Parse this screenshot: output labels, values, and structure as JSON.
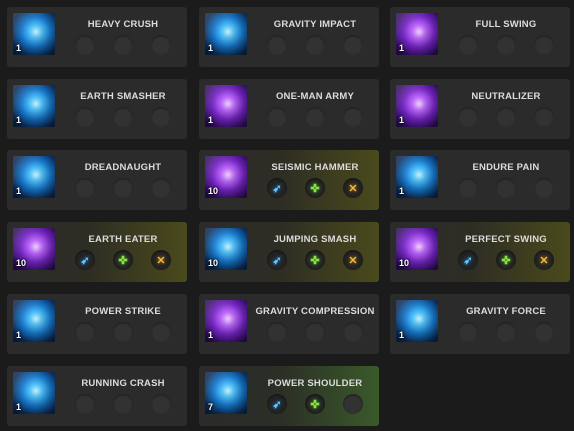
{
  "skills": [
    {
      "name": "HEAVY CRUSH",
      "level": "1",
      "theme": "blue",
      "highlight": "none",
      "tripods": [
        "",
        "",
        ""
      ]
    },
    {
      "name": "GRAVITY IMPACT",
      "level": "1",
      "theme": "blue",
      "highlight": "none",
      "tripods": [
        "",
        "",
        ""
      ]
    },
    {
      "name": "FULL SWING",
      "level": "1",
      "theme": "purple",
      "highlight": "none",
      "tripods": [
        "",
        "",
        ""
      ]
    },
    {
      "name": "EARTH SMASHER",
      "level": "1",
      "theme": "blue",
      "highlight": "none",
      "tripods": [
        "",
        "",
        ""
      ]
    },
    {
      "name": "ONE-MAN ARMY",
      "level": "1",
      "theme": "purple",
      "highlight": "none",
      "tripods": [
        "",
        "",
        ""
      ]
    },
    {
      "name": "NEUTRALIZER",
      "level": "1",
      "theme": "purple",
      "highlight": "none",
      "tripods": [
        "",
        "",
        ""
      ]
    },
    {
      "name": "DREADNAUGHT",
      "level": "1",
      "theme": "blue",
      "highlight": "none",
      "tripods": [
        "",
        "",
        ""
      ]
    },
    {
      "name": "SEISMIC HAMMER",
      "level": "10",
      "theme": "purple",
      "highlight": "yellow",
      "tripods": [
        "blue",
        "green",
        "gold"
      ]
    },
    {
      "name": "ENDURE PAIN",
      "level": "1",
      "theme": "blue",
      "highlight": "none",
      "tripods": [
        "",
        "",
        ""
      ]
    },
    {
      "name": "EARTH EATER",
      "level": "10",
      "theme": "purple",
      "highlight": "yellow",
      "tripods": [
        "blue",
        "green",
        "gold"
      ]
    },
    {
      "name": "JUMPING SMASH",
      "level": "10",
      "theme": "blue",
      "highlight": "yellow",
      "tripods": [
        "blue",
        "green",
        "gold"
      ]
    },
    {
      "name": "PERFECT SWING",
      "level": "10",
      "theme": "purple",
      "highlight": "yellow",
      "tripods": [
        "blue",
        "green",
        "gold"
      ]
    },
    {
      "name": "POWER STRIKE",
      "level": "1",
      "theme": "blue",
      "highlight": "none",
      "tripods": [
        "",
        "",
        ""
      ]
    },
    {
      "name": "GRAVITY COMPRESSION",
      "level": "1",
      "theme": "purple",
      "highlight": "none",
      "tripods": [
        "",
        "",
        ""
      ]
    },
    {
      "name": "GRAVITY FORCE",
      "level": "1",
      "theme": "blue",
      "highlight": "none",
      "tripods": [
        "",
        "",
        ""
      ]
    },
    {
      "name": "RUNNING CRASH",
      "level": "1",
      "theme": "blue",
      "highlight": "none",
      "tripods": [
        "",
        "",
        ""
      ]
    },
    {
      "name": "POWER SHOULDER",
      "level": "7",
      "theme": "blue",
      "highlight": "green",
      "tripods": [
        "blue",
        "green",
        ""
      ]
    }
  ],
  "tripod_glyphs": {
    "blue": "➶",
    "green": "✜",
    "gold": "✕"
  },
  "colors": {
    "background": "#1b1b1b",
    "card": "#2b2b2b",
    "highlight_yellow": "#4a4a1c",
    "highlight_green": "#3a5a2a"
  }
}
